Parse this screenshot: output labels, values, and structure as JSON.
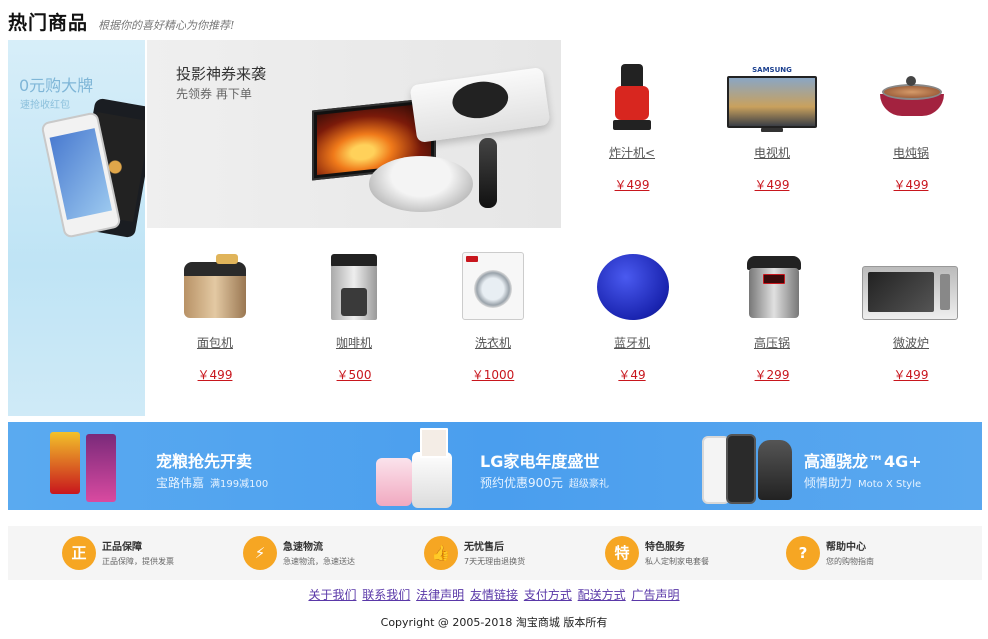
{
  "header": {
    "title": "热门商品",
    "slogan": "根据你的喜好精心为你推荐!"
  },
  "left_banner": {
    "title": "0元购大牌",
    "subtitle": "速抢收红包"
  },
  "projector_banner": {
    "title": "投影神券来袭",
    "subtitle": "先领券 再下单"
  },
  "products": [
    {
      "name": "炸汁机<",
      "price": "￥499",
      "icon": "juicer-icon"
    },
    {
      "name": "电视机",
      "price": "￥499",
      "icon": "tv-icon",
      "brand": "SAMSUNG"
    },
    {
      "name": "电炖锅",
      "price": "￥499",
      "icon": "electric-pot-icon"
    },
    {
      "name": "面包机",
      "price": "￥499",
      "icon": "bread-maker-icon"
    },
    {
      "name": "咖啡机",
      "price": "￥500",
      "icon": "coffee-machine-icon"
    },
    {
      "name": "洗衣机",
      "price": "￥1000",
      "icon": "washing-machine-icon"
    },
    {
      "name": "蓝牙机",
      "price": "￥49",
      "icon": "bluetooth-robot-icon"
    },
    {
      "name": "高压锅",
      "price": "￥299",
      "icon": "pressure-cooker-icon"
    },
    {
      "name": "微波炉",
      "price": "￥499",
      "icon": "microwave-icon"
    }
  ],
  "promo": [
    {
      "title": "宠粮抢先开卖",
      "sub": "宝路伟嘉",
      "extra": "满199减100"
    },
    {
      "title": "LG家电年度盛世",
      "sub": "预约优惠900元",
      "extra": "超级豪礼"
    },
    {
      "title": "高通骁龙™4G+",
      "sub": "倾情助力",
      "extra": "Moto X Style"
    }
  ],
  "services": [
    {
      "icon_char": "正",
      "icon": "genuine-icon",
      "title": "正品保障",
      "desc": "正品保障，提供发票"
    },
    {
      "icon_char": "⚡",
      "icon": "fast-delivery-icon",
      "title": "急速物流",
      "desc": "急速物流，急速送达"
    },
    {
      "icon_char": "👍",
      "icon": "thumbs-up-icon",
      "title": "无忧售后",
      "desc": "7天无理由退换货"
    },
    {
      "icon_char": "特",
      "icon": "special-service-icon",
      "title": "特色服务",
      "desc": "私人定制家电套餐"
    },
    {
      "icon_char": "?",
      "icon": "help-icon",
      "title": "帮助中心",
      "desc": "您的购物指南"
    }
  ],
  "footer": {
    "links": [
      "关于我们",
      "联系我们",
      "法律声明",
      "友情链接",
      "支付方式",
      "配送方式",
      "广告声明"
    ],
    "copyright": "Copyright @ 2005-2018 淘宝商城 版本所有"
  },
  "colors": {
    "price": "#c8161d",
    "promo_bg": "#4a9eee",
    "service_icon": "#f6a623",
    "link": "#5a38a8"
  }
}
